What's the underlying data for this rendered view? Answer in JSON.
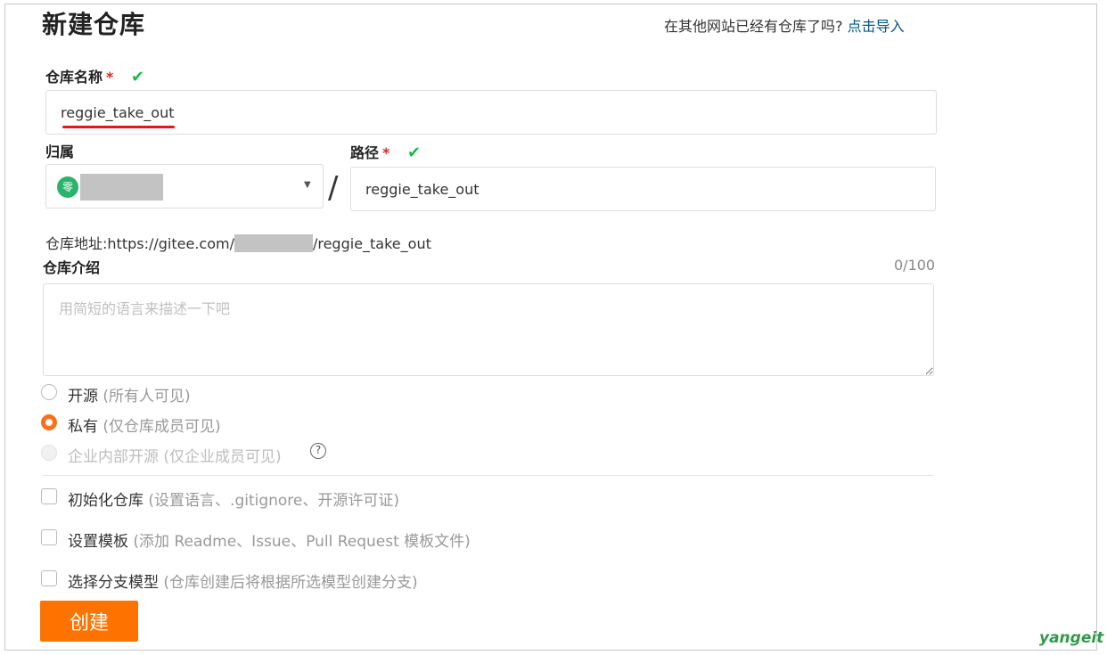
{
  "header": {
    "title": "新建仓库",
    "import_prompt": "在其他网站已经有仓库了吗?",
    "import_link": "点击导入"
  },
  "repo_name": {
    "label": "仓库名称",
    "required_mark": "*",
    "value": "reggie_take_out"
  },
  "owner": {
    "label": "归属",
    "avatar_text": "零"
  },
  "path": {
    "label": "路径",
    "required_mark": "*",
    "separator": "/",
    "value": "reggie_take_out"
  },
  "address": {
    "label": "仓库地址:",
    "prefix": "https://gitee.com/",
    "suffix": "/reggie_take_out"
  },
  "description": {
    "label": "仓库介绍",
    "counter": "0/100",
    "placeholder": "用简短的语言来描述一下吧"
  },
  "visibility": {
    "options": [
      {
        "label": "开源",
        "hint": "(所有人可见)",
        "state": "unselected"
      },
      {
        "label": "私有",
        "hint": "(仅仓库成员可见)",
        "state": "selected"
      },
      {
        "label": "企业内部开源",
        "hint": "(仅企业成员可见)",
        "state": "disabled"
      }
    ],
    "help_symbol": "?"
  },
  "options": [
    {
      "label": "初始化仓库",
      "hint": "(设置语言、.gitignore、开源许可证)",
      "checked": false
    },
    {
      "label": "设置模板",
      "hint": "(添加 Readme、Issue、Pull Request 模板文件)",
      "checked": false
    },
    {
      "label": "选择分支模型",
      "hint": "(仓库创建后将根据所选模型创建分支)",
      "checked": false
    }
  ],
  "submit": {
    "label": "创建"
  },
  "watermark": "yangeit",
  "colors": {
    "accent": "#fe7300",
    "link": "#005980",
    "valid": "#21ba45",
    "required": "#db2828"
  }
}
